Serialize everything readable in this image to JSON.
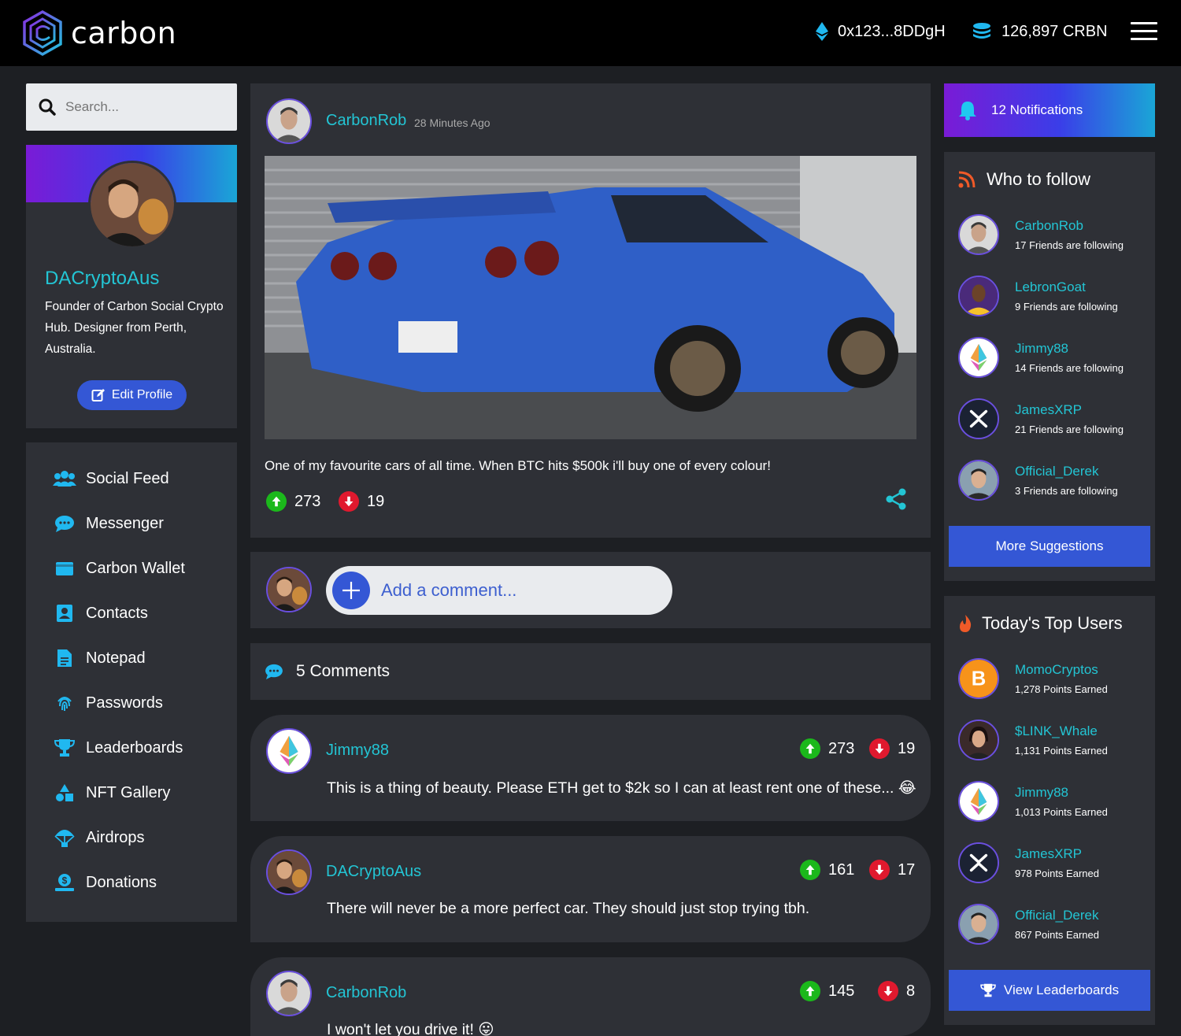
{
  "header": {
    "brand": "carbon",
    "wallet_address": "0x123...8DDgH",
    "balance": "126,897 CRBN"
  },
  "search": {
    "placeholder": "Search..."
  },
  "profile": {
    "name": "DACryptoAus",
    "bio": "Founder of Carbon Social Crypto Hub. Designer from Perth, Australia.",
    "edit_label": "Edit Profile"
  },
  "nav": {
    "items": [
      {
        "label": "Social Feed",
        "icon": "users-icon"
      },
      {
        "label": "Messenger",
        "icon": "chat-icon"
      },
      {
        "label": "Carbon Wallet",
        "icon": "wallet-icon"
      },
      {
        "label": "Contacts",
        "icon": "contact-card-icon"
      },
      {
        "label": "Notepad",
        "icon": "file-icon"
      },
      {
        "label": "Passwords",
        "icon": "fingerprint-icon"
      },
      {
        "label": "Leaderboards",
        "icon": "trophy-icon"
      },
      {
        "label": "NFT Gallery",
        "icon": "shapes-icon"
      },
      {
        "label": "Airdrops",
        "icon": "parachute-icon"
      },
      {
        "label": "Donations",
        "icon": "donate-icon"
      }
    ]
  },
  "post": {
    "user": "CarbonRob",
    "time": "28 Minutes Ago",
    "text": "One of my favourite cars of all time. When BTC hits $500k i'll buy one of every colour!",
    "upvotes": "273",
    "downvotes": "19"
  },
  "comment_input": {
    "placeholder": "Add a comment..."
  },
  "comments_header": "5 Comments",
  "comments": [
    {
      "user": "Jimmy88",
      "text": "This is a thing of beauty. Please ETH get to $2k so I can at least rent one of these... 😂",
      "upvotes": "273",
      "downvotes": "19"
    },
    {
      "user": "DACryptoAus",
      "text": "There will never be a more perfect car. They should just stop trying tbh.",
      "upvotes": "161",
      "downvotes": "17"
    },
    {
      "user": "CarbonRob",
      "text": "I won't let you drive it! 😛",
      "upvotes": "145",
      "downvotes": "8"
    }
  ],
  "notifications": {
    "label": "12 Notifications"
  },
  "who_to_follow": {
    "title": "Who to follow",
    "users": [
      {
        "name": "CarbonRob",
        "meta": "17 Friends are following"
      },
      {
        "name": "LebronGoat",
        "meta": "9 Friends are following"
      },
      {
        "name": "Jimmy88",
        "meta": "14 Friends are following"
      },
      {
        "name": "JamesXRP",
        "meta": "21 Friends are following"
      },
      {
        "name": "Official_Derek",
        "meta": "3 Friends are following"
      }
    ],
    "button": "More Suggestions"
  },
  "top_users": {
    "title": "Today's Top Users",
    "users": [
      {
        "name": "MomoCryptos",
        "meta": "1,278 Points Earned"
      },
      {
        "name": "$LINK_Whale",
        "meta": "1,131 Points Earned"
      },
      {
        "name": "Jimmy88",
        "meta": "1,013 Points Earned"
      },
      {
        "name": "JamesXRP",
        "meta": "978 Points Earned"
      },
      {
        "name": "Official_Derek",
        "meta": "867 Points Earned"
      }
    ],
    "button": "View Leaderboards"
  },
  "colors": {
    "accent_cyan": "#23c5d4",
    "button_blue": "#3457d5",
    "upvote_green": "#1bb81b",
    "downvote_red": "#e0192e",
    "card_bg": "#2e3036",
    "page_bg": "#1d1f23"
  }
}
